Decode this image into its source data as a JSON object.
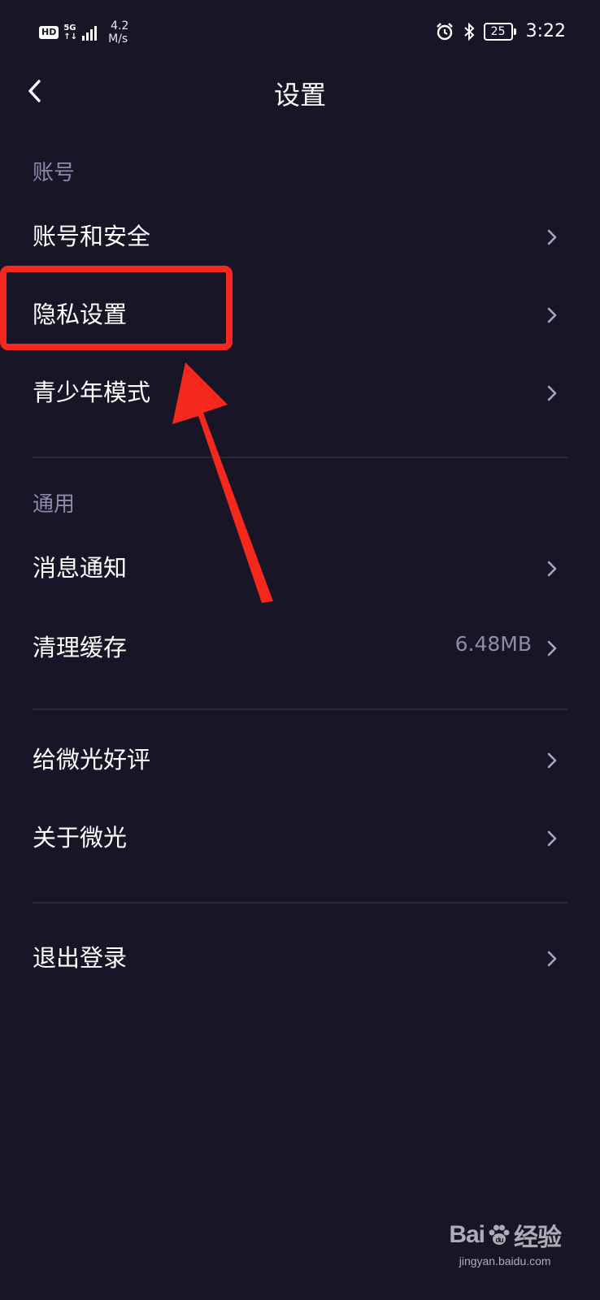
{
  "status_bar": {
    "hd_badge": "HD",
    "net_type_top": "5G",
    "net_type_bottom": "↑↓",
    "speed_value": "4.2",
    "speed_unit": "M/s",
    "battery": "25",
    "time": "3:22",
    "icons": [
      "alarm-icon",
      "bluetooth-icon",
      "battery-icon",
      "signal-icon"
    ]
  },
  "nav": {
    "title": "设置",
    "back_icon": "back-chevron-icon"
  },
  "sections": [
    {
      "label": "账号",
      "items": [
        {
          "label": "账号和安全"
        },
        {
          "label": "隐私设置"
        },
        {
          "label": "青少年模式"
        }
      ]
    },
    {
      "label": "通用",
      "items": [
        {
          "label": "消息通知"
        },
        {
          "label": "清理缓存",
          "value": "6.48MB"
        }
      ]
    },
    {
      "label": "",
      "items": [
        {
          "label": "给微光好评"
        },
        {
          "label": "关于微光"
        }
      ]
    },
    {
      "label": "",
      "items": [
        {
          "label": "退出登录"
        }
      ]
    }
  ],
  "annotation": {
    "highlight_color": "#f5281e",
    "arrow_color": "#f5281e"
  },
  "watermark": {
    "brand_a": "Bai",
    "brand_b": "经验",
    "url": "jingyan.baidu.com"
  },
  "colors": {
    "background": "#181526",
    "secondary_text": "#8f89ab",
    "divider": "#2c283d"
  }
}
